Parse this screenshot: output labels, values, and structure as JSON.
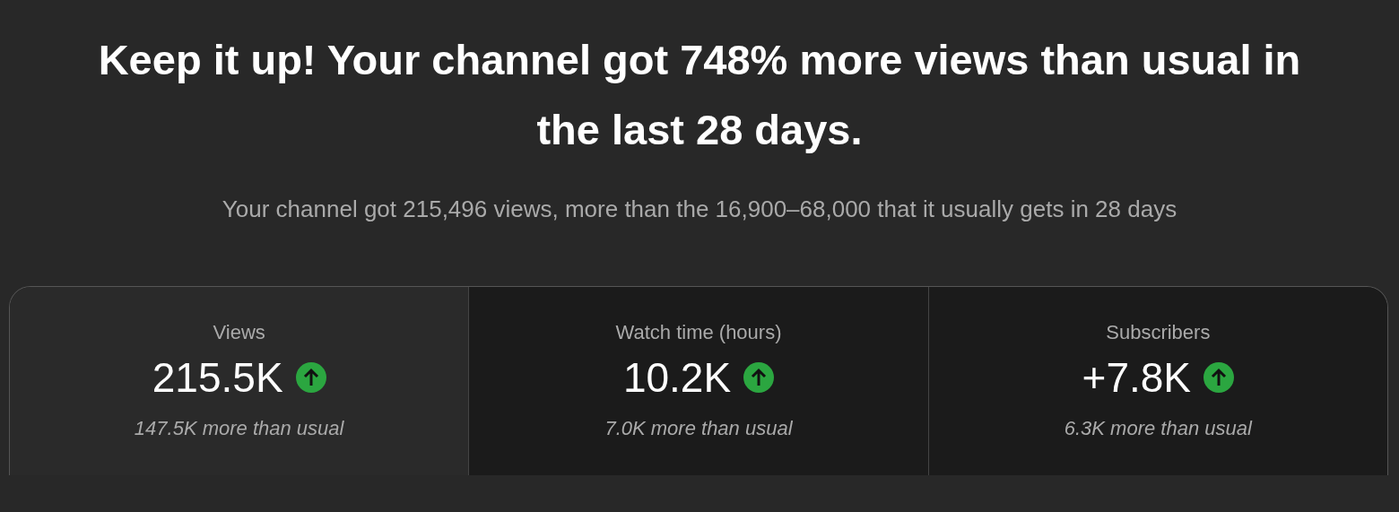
{
  "headline": "Keep it up! Your channel got 748% more views than usual in the last 28 days.",
  "summary": "Your channel got 215,496 views, more than the 16,900–68,000 that it usually gets in 28 days",
  "metrics": [
    {
      "label": "Views",
      "value": "215.5K",
      "kind": "up",
      "note": "147.5K more than usual",
      "selected": true
    },
    {
      "label": "Watch time (hours)",
      "value": "10.2K",
      "kind": "up",
      "note": "7.0K more than usual",
      "selected": false
    },
    {
      "label": "Subscribers",
      "value": "+7.8K",
      "kind": "up",
      "note": "6.3K more than usual",
      "selected": false
    }
  ]
}
